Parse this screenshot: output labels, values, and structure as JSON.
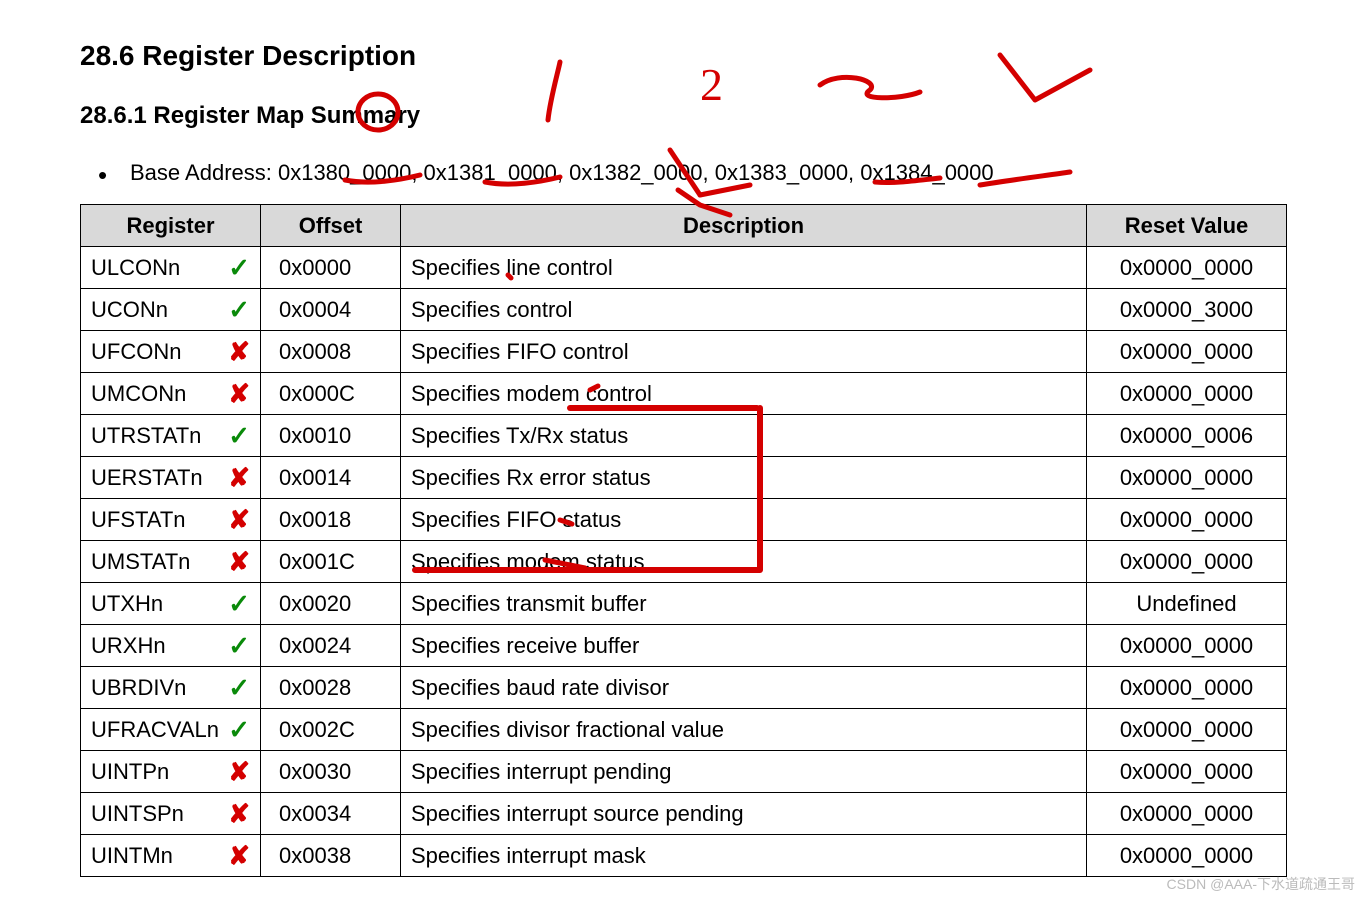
{
  "heading_main": "28.6 Register Description",
  "heading_sub": "28.6.1  Register Map Summary",
  "base_address_line": "Base Address: 0x1380_0000, 0x1381_0000, 0x1382_0000, 0x1383_0000, 0x1384_0000",
  "table": {
    "headers": {
      "register": "Register",
      "offset": "Offset",
      "description": "Description",
      "reset": "Reset Value"
    },
    "rows": [
      {
        "register": "ULCONn",
        "offset": "0x0000",
        "description": "Specifies line control",
        "reset": "0x0000_0000",
        "mark": "check"
      },
      {
        "register": "UCONn",
        "offset": "0x0004",
        "description": "Specifies control",
        "reset": "0x0000_3000",
        "mark": "check"
      },
      {
        "register": "UFCONn",
        "offset": "0x0008",
        "description": "Specifies FIFO control",
        "reset": "0x0000_0000",
        "mark": "cross"
      },
      {
        "register": "UMCONn",
        "offset": "0x000C",
        "description": "Specifies modem control",
        "reset": "0x0000_0000",
        "mark": "cross"
      },
      {
        "register": "UTRSTATn",
        "offset": "0x0010",
        "description": "Specifies Tx/Rx status",
        "reset": "0x0000_0006",
        "mark": "check"
      },
      {
        "register": "UERSTATn",
        "offset": "0x0014",
        "description": "Specifies Rx error status",
        "reset": "0x0000_0000",
        "mark": "cross"
      },
      {
        "register": "UFSTATn",
        "offset": "0x0018",
        "description": "Specifies FIFO status",
        "reset": "0x0000_0000",
        "mark": "cross"
      },
      {
        "register": "UMSTATn",
        "offset": "0x001C",
        "description": "Specifies modem status",
        "reset": "0x0000_0000",
        "mark": "cross"
      },
      {
        "register": "UTXHn",
        "offset": "0x0020",
        "description": "Specifies transmit buffer",
        "reset": "Undefined",
        "mark": "check"
      },
      {
        "register": "URXHn",
        "offset": "0x0024",
        "description": "Specifies receive buffer",
        "reset": "0x0000_0000",
        "mark": "check"
      },
      {
        "register": "UBRDIVn",
        "offset": "0x0028",
        "description": "Specifies baud rate divisor",
        "reset": "0x0000_0000",
        "mark": "check"
      },
      {
        "register": "UFRACVALn",
        "offset": "0x002C",
        "description": "Specifies divisor fractional value",
        "reset": "0x0000_0000",
        "mark": "check"
      },
      {
        "register": "UINTPn",
        "offset": "0x0030",
        "description": "Specifies interrupt pending",
        "reset": "0x0000_0000",
        "mark": "cross"
      },
      {
        "register": "UINTSPn",
        "offset": "0x0034",
        "description": "Specifies interrupt source pending",
        "reset": "0x0000_0000",
        "mark": "cross"
      },
      {
        "register": "UINTMn",
        "offset": "0x0038",
        "description": "Specifies interrupt mask",
        "reset": "0x0000_0000",
        "mark": "cross"
      }
    ]
  },
  "handwritten_numbers": [
    "1",
    "2",
    "3",
    "4"
  ],
  "watermark": "CSDN @AAA-下水道疏通王哥"
}
